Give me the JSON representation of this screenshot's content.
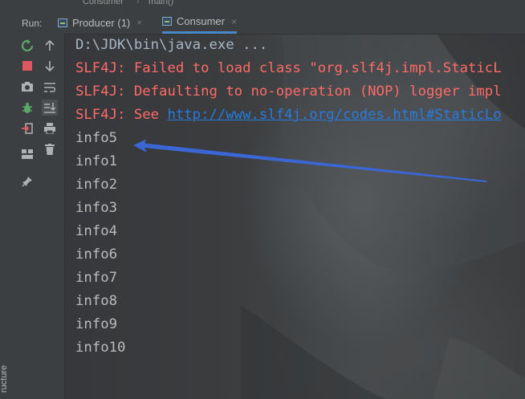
{
  "breadcrumb": {
    "items": [
      "Consumer",
      "main()"
    ]
  },
  "run_panel": {
    "label": "Run:",
    "tabs": [
      {
        "label": "Producer (1)",
        "active": false
      },
      {
        "label": "Consumer",
        "active": true
      }
    ],
    "close_glyph": "×"
  },
  "side_panel": {
    "structure_label": "ructure"
  },
  "toolbar": {
    "primary_icons": [
      "rerun-icon",
      "stop-icon",
      "camera-icon",
      "debug-bug-icon",
      "login-exit-icon",
      "layout-icon",
      "pin-icon"
    ],
    "secondary_icons": [
      "arrow-up-icon",
      "arrow-down-icon",
      "soft-wrap-icon",
      "scroll-to-end-icon",
      "print-icon",
      "trash-icon"
    ]
  },
  "console": {
    "command": "D:\\JDK\\bin\\java.exe ...",
    "errors": [
      "SLF4J: Failed to load class \"org.slf4j.impl.StaticL",
      "SLF4J: Defaulting to no-operation (NOP) logger impl"
    ],
    "see_prefix": "SLF4J: See ",
    "see_link": "http://www.slf4j.org/codes.html#StaticLo",
    "output": [
      "info5",
      "info1",
      "info2",
      "info3",
      "info4",
      "info6",
      "info7",
      "info8",
      "info9",
      "info10"
    ]
  },
  "colors": {
    "background": "#2b2b2b",
    "panel": "#3c3f41",
    "error_text": "#ff6b68",
    "normal_text": "#bbbbbb",
    "link": "#287bde",
    "annotation_arrow": "#3b67d6",
    "active_tab_underline": "#4a88c7"
  }
}
